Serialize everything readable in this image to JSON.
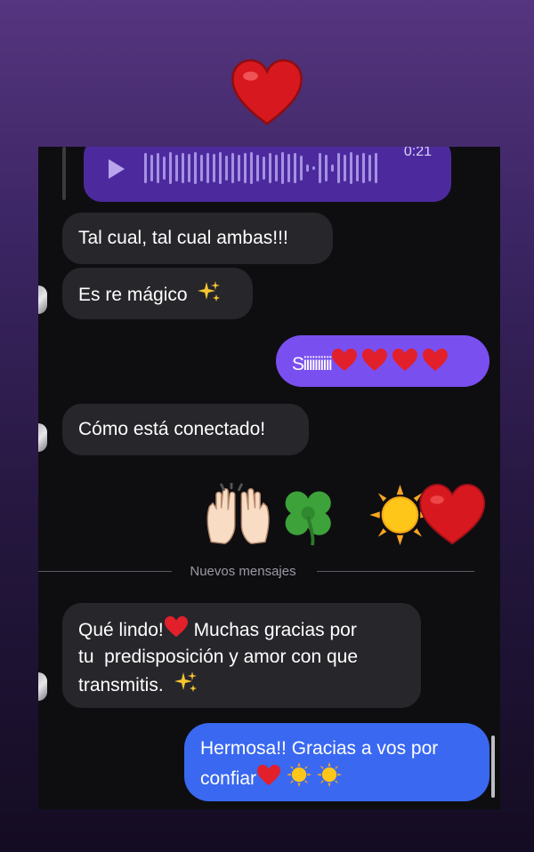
{
  "story": {
    "sticker": "heart-emoji"
  },
  "voice_message": {
    "duration": "0:21",
    "progress": 0.0
  },
  "messages": [
    {
      "text": "Tal cual, tal cual ambas!!!"
    },
    {
      "text": "Es re mágico",
      "emoji_after": "sparkles"
    },
    {
      "text": "Siiiiiiiiii",
      "emoji_after": "hearts x4"
    },
    {
      "text": "Cómo está conectado!"
    },
    {
      "emoji_only": [
        "raising-hands",
        "four-leaf-clover",
        "sun",
        "red-heart"
      ]
    },
    {
      "line1_a": "Qué lindo!",
      "line1_b": " Muchas gracias por",
      "line2": "tu  predisposición y amor con que",
      "line3": "transmitis."
    },
    {
      "line1": "Hermosa!! Gracias a vos por",
      "line2": "confiar"
    }
  ],
  "divider": {
    "label": "Nuevos mensajes"
  },
  "colors": {
    "incoming_bubble": "#26262b",
    "outgoing_purple": "#7a4ff0",
    "outgoing_blue": "#3a68f0",
    "voice_bubble": "#4c2a9e",
    "chat_background": "#0e0e11"
  }
}
